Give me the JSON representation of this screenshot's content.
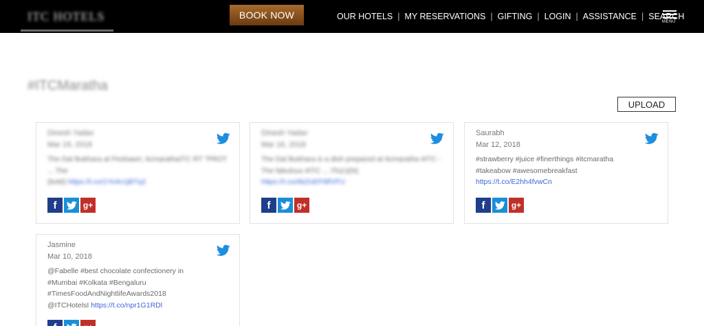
{
  "header": {
    "logo_text": "ITC HOTELS",
    "book_now": "BOOK NOW",
    "nav": [
      "OUR HOTELS",
      "MY RESERVATIONS",
      "GIFTING",
      "LOGIN",
      "ASSISTANCE",
      "SEARCH"
    ],
    "separator": "|",
    "menu_label": "MENU"
  },
  "page": {
    "hashtag": "#ITCMaratha",
    "upload": "UPLOAD"
  },
  "cards": [
    {
      "author": "Dinesh Yadav",
      "date": "Mar 19, 2018",
      "text": "The Dal Bukhara at Peshawri, ItcmarathaITC RT \"PROT ... The",
      "text_2": "&ntilde;\"",
      "link": "https://t.co/1Yo4v1jBTq2",
      "pre_link": "(bold) ",
      "blurred": true
    },
    {
      "author": "Dinesh Yadav",
      "date": "Mar 16, 2018",
      "text": "The Dal Bukhara is a dish prepared at Itcmaratha #ITC - The fabulous #ITC ... ITc(c)(N)",
      "text_2": "",
      "link": "https://t.co/AkZoEFt8fVFU",
      "pre_link": "",
      "blurred": true
    },
    {
      "author": "Saurabh",
      "date": "Mar 12, 2018",
      "text": "#strawberry #juice #finerthings #itcmaratha #takeabow #awesomebreakfast",
      "text_2": "",
      "link": "https://t.co/E2hh4fvwCn",
      "pre_link": "",
      "blurred": false
    },
    {
      "author": "Jasmine",
      "date": "Mar 10, 2018",
      "text": "@Fabelle #best chocolate confectionery in #Mumbai #Kolkata #Bengaluru #TimesFoodAndNightlifeAwards2018 @ITCHotelsI",
      "text_2": "",
      "link": "https://t.co/npr1G1RDl",
      "pre_link": "",
      "blurred": false
    }
  ],
  "colors": {
    "header_bg": "#000000",
    "book_now_bg": "#8a5520",
    "facebook": "#1f3d8a",
    "twitter": "#1a8fd8",
    "google_plus": "#c0302a",
    "link": "#3a66d8"
  },
  "icons": [
    "twitter-bird-icon",
    "facebook-icon",
    "twitter-icon",
    "google-plus-icon",
    "hamburger-menu-icon"
  ]
}
